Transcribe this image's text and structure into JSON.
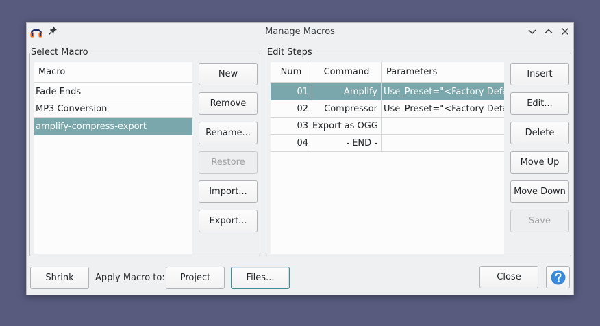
{
  "window": {
    "title": "Manage Macros",
    "app_icon": "audacity-headphones-icon",
    "pin_icon": "pin-icon",
    "controls": [
      "minimize-icon",
      "maximize-icon",
      "close-icon"
    ]
  },
  "select_macro": {
    "group_label": "Select Macro",
    "column_header": "Macro",
    "macros": [
      "Fade Ends",
      "MP3 Conversion",
      "amplify-compress-export"
    ],
    "selected_index": 2,
    "buttons": {
      "new": "New",
      "remove": "Remove",
      "rename": "Rename...",
      "restore": "Restore",
      "import": "Import...",
      "export": "Export..."
    }
  },
  "edit_steps": {
    "group_label": "Edit Steps",
    "columns": {
      "num": "Num",
      "command": "Command",
      "parameters": "Parameters"
    },
    "steps": [
      {
        "num": "01",
        "command": "Amplify",
        "parameters": "Use_Preset=\"<Factory Defaults>\""
      },
      {
        "num": "02",
        "command": "Compressor",
        "parameters": "Use_Preset=\"<Factory Defaults>\""
      },
      {
        "num": "03",
        "command": "Export as OGG",
        "parameters": ""
      },
      {
        "num": "04",
        "command": "- END -",
        "parameters": ""
      }
    ],
    "selected_index": 0,
    "buttons": {
      "insert": "Insert",
      "edit": "Edit...",
      "delete": "Delete",
      "move_up": "Move Up",
      "move_down": "Move Down",
      "save": "Save"
    }
  },
  "footer": {
    "shrink": "Shrink",
    "apply_label": "Apply Macro to:",
    "project": "Project",
    "files": "Files...",
    "close": "Close",
    "help_icon": "help-icon"
  },
  "colors": {
    "selection": "#79a7ac",
    "desktop": "#585a7e",
    "window_bg": "#eff0f1",
    "help_button": "#3b8ad9"
  }
}
